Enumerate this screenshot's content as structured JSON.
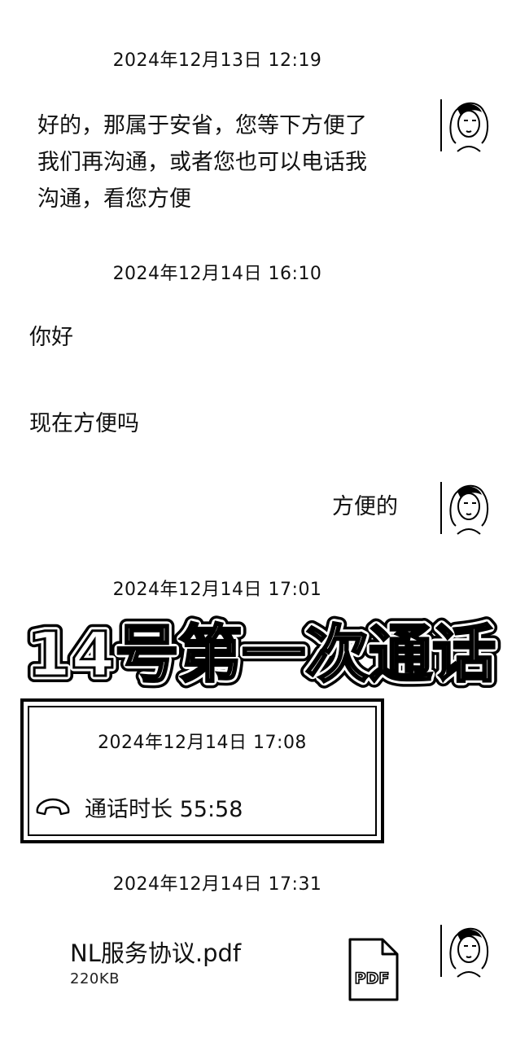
{
  "messages": [
    {
      "timestamp": "2024年12月13日 12:19",
      "text_lines": [
        "好的，那属于安省，您等下方便了",
        "我们再沟通，或者您也可以电话我",
        "沟通，看您方便"
      ]
    },
    {
      "timestamp": "2024年12月14日 16:10",
      "text": "你好"
    },
    {
      "text": "现在方便吗"
    },
    {
      "text": "方便的"
    },
    {
      "timestamp": "2024年12月14日 17:01"
    }
  ],
  "banner": {
    "text": "14号第一次通话"
  },
  "call": {
    "timestamp": "2024年12月14日 17:08",
    "label": "通话时长 55:58",
    "icon": "phone-handset-icon"
  },
  "file_message": {
    "timestamp": "2024年12月14日 17:31",
    "name": "NL服务协议.pdf",
    "size": "220KB",
    "icon_label": "PDF",
    "icon": "pdf-file-icon"
  }
}
